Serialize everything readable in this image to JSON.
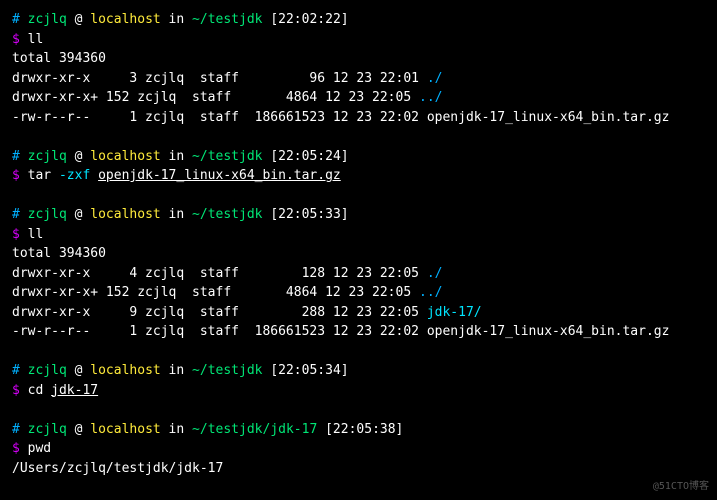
{
  "blocks": [
    {
      "prompt": {
        "hash": "#",
        "user": "zcjlq",
        "at": "@",
        "host": "localhost",
        "in": "in",
        "path": "~/testjdk",
        "time": "[22:02:22]"
      },
      "command": {
        "dollar": "$",
        "cmd": "ll",
        "arg": "",
        "underlined": false
      },
      "output": [
        "total 394360",
        "drwxr-xr-x     3 zcjlq  staff         96 12 23 22:01 ./",
        "drwxr-xr-x+ 152 zcjlq  staff       4864 12 23 22:05 ../",
        "-rw-r--r--     1 zcjlq  staff  186661523 12 23 22:02 openjdk-17_linux-x64_bin.tar.gz"
      ],
      "outputDirs": [
        null,
        "./",
        "../",
        null
      ]
    },
    {
      "prompt": {
        "hash": "#",
        "user": "zcjlq",
        "at": "@",
        "host": "localhost",
        "in": "in",
        "path": "~/testjdk",
        "time": "[22:05:24]"
      },
      "command": {
        "dollar": "$",
        "cmd": "tar",
        "arg": "-zxf openjdk-17_linux-x64_bin.tar.gz",
        "underlined": true,
        "cmdFlag": "-zxf",
        "cmdFile": "openjdk-17_linux-x64_bin.tar.gz"
      },
      "output": [],
      "outputDirs": []
    },
    {
      "prompt": {
        "hash": "#",
        "user": "zcjlq",
        "at": "@",
        "host": "localhost",
        "in": "in",
        "path": "~/testjdk",
        "time": "[22:05:33]"
      },
      "command": {
        "dollar": "$",
        "cmd": "ll",
        "arg": "",
        "underlined": false
      },
      "output": [
        "total 394360",
        "drwxr-xr-x     4 zcjlq  staff        128 12 23 22:05 ./",
        "drwxr-xr-x+ 152 zcjlq  staff       4864 12 23 22:05 ../",
        "drwxr-xr-x     9 zcjlq  staff        288 12 23 22:05 jdk-17/",
        "-rw-r--r--     1 zcjlq  staff  186661523 12 23 22:02 openjdk-17_linux-x64_bin.tar.gz"
      ],
      "outputDirs": [
        null,
        "./",
        "../",
        "jdk-17/",
        null
      ]
    },
    {
      "prompt": {
        "hash": "#",
        "user": "zcjlq",
        "at": "@",
        "host": "localhost",
        "in": "in",
        "path": "~/testjdk",
        "time": "[22:05:34]"
      },
      "command": {
        "dollar": "$",
        "cmd": "cd",
        "arg": "jdk-17",
        "underlined": true
      },
      "output": [],
      "outputDirs": []
    },
    {
      "prompt": {
        "hash": "#",
        "user": "zcjlq",
        "at": "@",
        "host": "localhost",
        "in": "in",
        "path": "~/testjdk/jdk-17",
        "time": "[22:05:38]"
      },
      "command": {
        "dollar": "$",
        "cmd": "pwd",
        "arg": "",
        "underlined": false
      },
      "output": [
        "/Users/zcjlq/testjdk/jdk-17"
      ],
      "outputDirs": [
        null
      ]
    }
  ],
  "watermark": "@51CTO博客"
}
